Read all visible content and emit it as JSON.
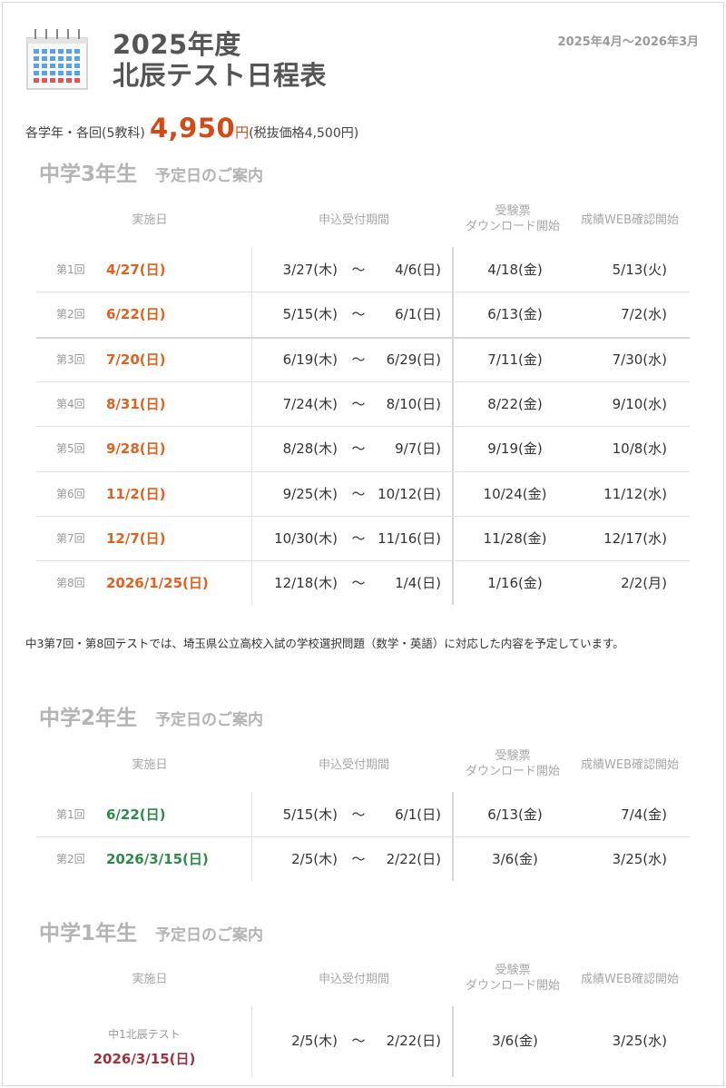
{
  "header": {
    "title_line1": "2025年度",
    "title_line2": "北辰テスト日程表",
    "period": "2025年4月～2026年3月",
    "icon": "calendar-icon"
  },
  "price": {
    "prefix": "各学年・各回(5教科)",
    "amount": "4,950",
    "yen": "円",
    "tax_note": "(税抜価格4,500円)"
  },
  "columns": {
    "date": "実施日",
    "apply": "申込受付期間",
    "download": "受験票\nダウンロード開始",
    "web": "成績WEB確認開始"
  },
  "colors": {
    "accent_orange": "#e2611e",
    "price_red": "#d24a17",
    "accent_green": "#2f8a4a",
    "accent_maroon": "#9b3440"
  },
  "grade3": {
    "title": "中学3年生",
    "subtitle": "予定日のご案内",
    "rows": [
      {
        "kai": "第1回",
        "date": "4/27(日)",
        "from": "3/27(木)",
        "tilde": "～",
        "to": "4/6(日)",
        "dl": "4/18(金)",
        "web": "5/13(火)"
      },
      {
        "kai": "第2回",
        "date": "6/22(日)",
        "from": "5/15(木)",
        "tilde": "～",
        "to": "6/1(日)",
        "dl": "6/13(金)",
        "web": "7/2(水)"
      },
      {
        "kai": "第3回",
        "date": "7/20(日)",
        "from": "6/19(木)",
        "tilde": "～",
        "to": "6/29(日)",
        "dl": "7/11(金)",
        "web": "7/30(水)"
      },
      {
        "kai": "第4回",
        "date": "8/31(日)",
        "from": "7/24(木)",
        "tilde": "～",
        "to": "8/10(日)",
        "dl": "8/22(金)",
        "web": "9/10(水)"
      },
      {
        "kai": "第5回",
        "date": "9/28(日)",
        "from": "8/28(木)",
        "tilde": "～",
        "to": "9/7(日)",
        "dl": "9/19(金)",
        "web": "10/8(水)"
      },
      {
        "kai": "第6回",
        "date": "11/2(日)",
        "from": "9/25(木)",
        "tilde": "～",
        "to": "10/12(日)",
        "dl": "10/24(金)",
        "web": "11/12(水)"
      },
      {
        "kai": "第7回",
        "date": "12/7(日)",
        "from": "10/30(木)",
        "tilde": "～",
        "to": "11/16(日)",
        "dl": "11/28(金)",
        "web": "12/17(水)"
      },
      {
        "kai": "第8回",
        "date": "2026/1/25(日)",
        "from": "12/18(木)",
        "tilde": "～",
        "to": "1/4(日)",
        "dl": "1/16(金)",
        "web": "2/2(月)"
      }
    ],
    "note": "中3第7回・第8回テストでは、埼玉県公立高校入試の学校選択問題（数学・英語）に対応した内容を予定しています。"
  },
  "grade2": {
    "title": "中学2年生",
    "subtitle": "予定日のご案内",
    "rows": [
      {
        "kai": "第1回",
        "date": "6/22(日)",
        "from": "5/15(木)",
        "tilde": "～",
        "to": "6/1(日)",
        "dl": "6/13(金)",
        "web": "7/4(金)"
      },
      {
        "kai": "第2回",
        "date": "2026/3/15(日)",
        "from": "2/5(木)",
        "tilde": "～",
        "to": "2/22(日)",
        "dl": "3/6(金)",
        "web": "3/25(水)"
      }
    ]
  },
  "grade1": {
    "title": "中学1年生",
    "subtitle": "予定日のご案内",
    "row": {
      "label": "中1北辰テスト",
      "date": "2026/3/15(日)",
      "from": "2/5(木)",
      "tilde": "～",
      "to": "2/22(日)",
      "dl": "3/6(金)",
      "web": "3/25(水)"
    }
  }
}
